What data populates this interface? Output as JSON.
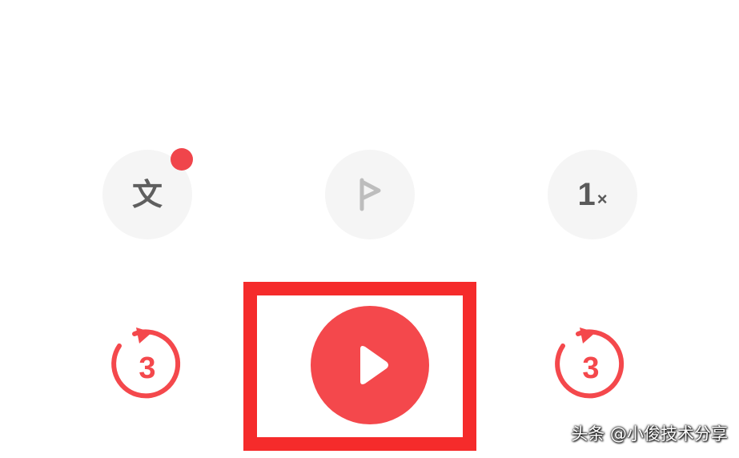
{
  "controls": {
    "text_button_glyph": "文",
    "speed_value": "1",
    "speed_suffix": "×",
    "skip_back_seconds": "3",
    "skip_forward_seconds": "3"
  },
  "colors": {
    "accent_red": "#f4484c",
    "highlight_red": "#f52b2b",
    "button_bg": "#f5f5f5",
    "icon_gray": "#5f5f5f"
  },
  "icons": {
    "text_button": "text-icon",
    "mark_button": "flag-icon",
    "speed_button": "speed-icon",
    "skip_back": "rewind-3-icon",
    "skip_forward": "forward-3-icon",
    "play": "play-icon"
  },
  "watermark": {
    "text": "头条 @小俊技术分享"
  }
}
